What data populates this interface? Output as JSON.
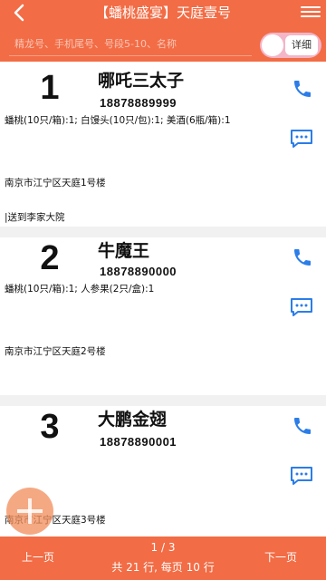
{
  "header": {
    "title": "【蟠桃盛宴】天庭壹号",
    "search_placeholder": "精龙号、手机尾号、号段5-10、名称",
    "detail_label": "详细"
  },
  "orders": [
    {
      "index": "1",
      "name": "哪吒三太子",
      "phone": "18878889999",
      "items": "蟠桃(10只/箱):1; 白馒头(10只/包):1; 美酒(6瓶/箱):1",
      "address": "南京市江宁区天庭1号楼",
      "note": "|送到李家大院"
    },
    {
      "index": "2",
      "name": "牛魔王",
      "phone": "18878890000",
      "items": "蟠桃(10只/箱):1; 人参果(2只/盒):1",
      "address": "南京市江宁区天庭2号楼"
    },
    {
      "index": "3",
      "name": "大鹏金翅",
      "phone": "18878890001",
      "items": "",
      "address": "南京市江宁区天庭3号楼"
    }
  ],
  "footer": {
    "prev_label": "上一页",
    "next_label": "下一页",
    "page": "1 / 3",
    "info": "共 21 行, 每页 10 行"
  },
  "colors": {
    "accent": "#f26c45",
    "icon_blue": "#2b7de9",
    "toggle_pink": "#f4b5c8"
  }
}
